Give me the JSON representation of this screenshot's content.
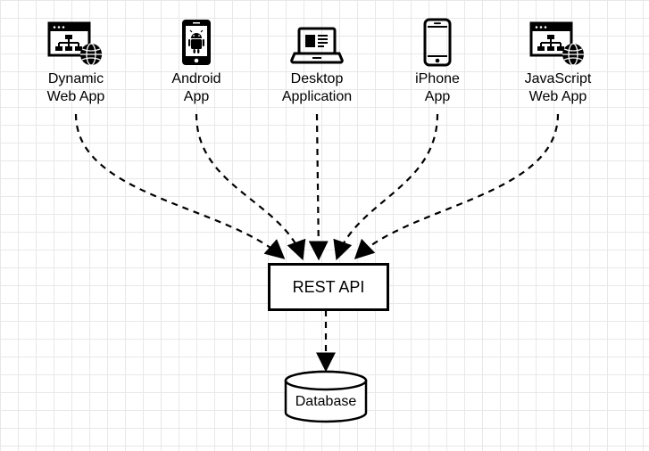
{
  "clients": [
    {
      "label_line1": "Dynamic",
      "label_line2": "Web App"
    },
    {
      "label_line1": "Android",
      "label_line2": "App"
    },
    {
      "label_line1": "Desktop",
      "label_line2": "Application"
    },
    {
      "label_line1": "iPhone",
      "label_line2": "App"
    },
    {
      "label_line1": "JavaScript",
      "label_line2": "Web App"
    }
  ],
  "rest_label": "REST API",
  "database_label": "Database"
}
